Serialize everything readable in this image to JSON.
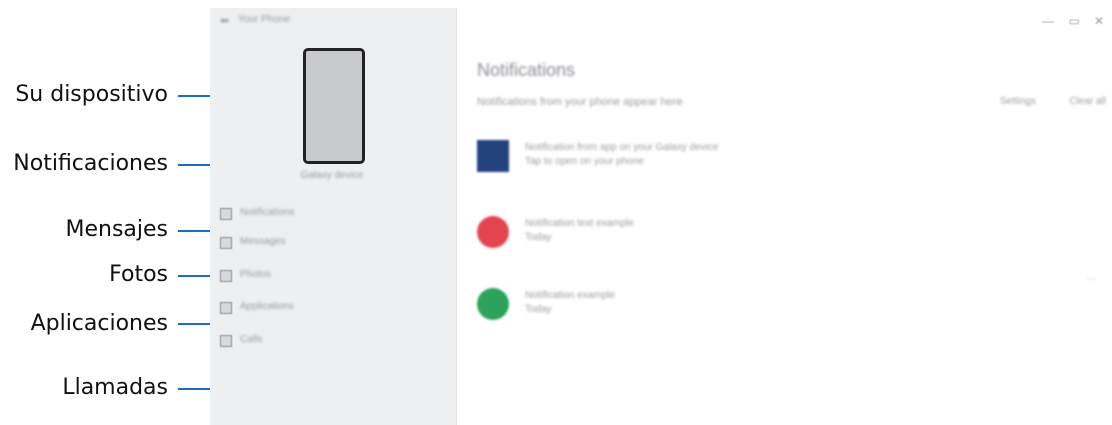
{
  "callouts": {
    "device": "Su dispositivo",
    "notifications": "Notificaciones",
    "messages": "Mensajes",
    "photos": "Fotos",
    "apps": "Aplicaciones",
    "calls": "Llamadas"
  },
  "window": {
    "title": "Your Phone",
    "controls": {
      "minimize": "—",
      "maximize": "▭",
      "close": "✕"
    }
  },
  "sidebar": {
    "back_icon": "back-arrow-icon",
    "device_name": "Galaxy device",
    "items": [
      {
        "label": "Notifications",
        "icon": "bell-icon"
      },
      {
        "label": "Messages",
        "icon": "message-icon"
      },
      {
        "label": "Photos",
        "icon": "photo-icon"
      },
      {
        "label": "Applications",
        "icon": "apps-icon"
      },
      {
        "label": "Calls",
        "icon": "phone-icon"
      }
    ]
  },
  "main": {
    "title": "Notifications",
    "subtitle": "Notifications from your phone appear here",
    "actions": [
      "Settings",
      "Clear all"
    ],
    "notifications": [
      {
        "title": "Notification from app on your Galaxy device",
        "subtitle": "Tap to open on your phone",
        "color": "#23427e"
      },
      {
        "title": "Notification text example",
        "subtitle": "Today",
        "color": "#e34550"
      },
      {
        "title": "Notification example",
        "subtitle": "Today",
        "color": "#2ca25a"
      }
    ]
  },
  "colors": {
    "leader_line": "#1a6fc0",
    "sidebar_bg": "#eeeff1"
  }
}
